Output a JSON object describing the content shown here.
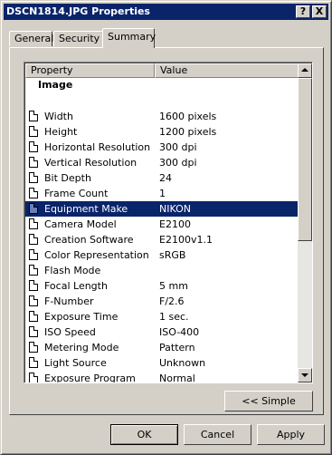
{
  "window": {
    "title": "DSCN1814.JPG Properties",
    "help_glyph": "?",
    "close_glyph": "X"
  },
  "tabs": [
    {
      "label": "General",
      "active": false
    },
    {
      "label": "Security",
      "active": false
    },
    {
      "label": "Summary",
      "active": true
    }
  ],
  "list": {
    "columns": [
      "Property",
      "Value"
    ],
    "section": "Image",
    "rows": [
      {
        "name": "Width",
        "value": "1600 pixels",
        "selected": false
      },
      {
        "name": "Height",
        "value": "1200 pixels",
        "selected": false
      },
      {
        "name": "Horizontal Resolution",
        "value": "300 dpi",
        "selected": false
      },
      {
        "name": "Vertical Resolution",
        "value": "300 dpi",
        "selected": false
      },
      {
        "name": "Bit Depth",
        "value": "24",
        "selected": false
      },
      {
        "name": "Frame Count",
        "value": "1",
        "selected": false
      },
      {
        "name": "Equipment Make",
        "value": "NIKON",
        "selected": true
      },
      {
        "name": "Camera Model",
        "value": "E2100",
        "selected": false
      },
      {
        "name": "Creation Software",
        "value": "E2100v1.1",
        "selected": false
      },
      {
        "name": "Color Representation",
        "value": "sRGB",
        "selected": false
      },
      {
        "name": "Flash Mode",
        "value": "",
        "selected": false
      },
      {
        "name": "Focal Length",
        "value": "5 mm",
        "selected": false
      },
      {
        "name": "F-Number",
        "value": "F/2.6",
        "selected": false
      },
      {
        "name": "Exposure Time",
        "value": "1 sec.",
        "selected": false
      },
      {
        "name": "ISO Speed",
        "value": "ISO-400",
        "selected": false
      },
      {
        "name": "Metering Mode",
        "value": "Pattern",
        "selected": false
      },
      {
        "name": "Light Source",
        "value": "Unknown",
        "selected": false
      },
      {
        "name": "Exposure Program",
        "value": "Normal",
        "selected": false
      }
    ]
  },
  "buttons": {
    "simple": "<< Simple",
    "ok": "OK",
    "cancel": "Cancel",
    "apply": "Apply"
  },
  "colors": {
    "titlebar": "#0a246a",
    "face": "#d4d0c8",
    "selection": "#0a246a"
  }
}
